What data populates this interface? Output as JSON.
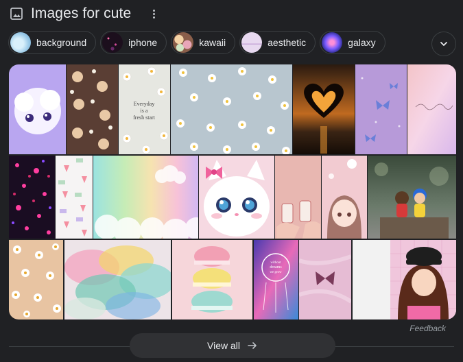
{
  "header": {
    "title": "Images for cute"
  },
  "chips": [
    {
      "label": "background",
      "icon": "background-thumbnail"
    },
    {
      "label": "iphone",
      "icon": "iphone-thumbnail"
    },
    {
      "label": "kawaii",
      "icon": "kawaii-thumbnail"
    },
    {
      "label": "aesthetic",
      "icon": "aesthetic-thumbnail"
    },
    {
      "label": "galaxy",
      "icon": "galaxy-thumbnail"
    }
  ],
  "more_icon": "chevron-down-icon",
  "tiles": [
    "fluffy-white-creature",
    "teddy-bear-pattern",
    "daisy-everyday-fresh-start",
    "daisy-pattern-blue",
    "heart-hands-sunset",
    "purple-butterflies",
    "pink-pastel-script",
    "neon-hearts-dark",
    "strawberry-pattern",
    "pastel-rainbow-clouds",
    "white-kitten-pink-bow",
    "pink-drinks-illustration",
    "anime-girl-pink",
    "couple-figurines",
    "peach-daisy-pattern",
    "colorful-smoke",
    "pastel-macarons",
    "dreamcatcher-galaxy",
    "pink-butterfly-marble",
    "girl-cap-pink-grid"
  ],
  "everyday_text": [
    "Everyday",
    "is a",
    "fresh start"
  ],
  "dreams_text": [
    "without",
    "dreams",
    "we grow"
  ],
  "feedback": "Feedback",
  "view_all": "View all",
  "colors": {
    "background": "#202124",
    "chip_border": "#3c4043",
    "text": "#e8eaed",
    "button": "#303134"
  }
}
